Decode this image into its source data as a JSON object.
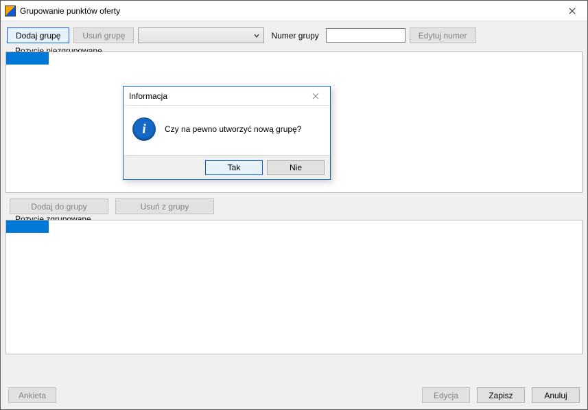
{
  "window": {
    "title": "Grupowanie punktów oferty"
  },
  "toolbar": {
    "add_group": "Dodaj grupę",
    "remove_group": "Usuń grupę",
    "number_label": "Numer grupy",
    "number_value": "",
    "edit_number": "Edytuj numer",
    "combo_selected": ""
  },
  "groups": {
    "ungrouped_label": "Pozycje niezgrupowane",
    "grouped_label": "Pozycje zgrupowane"
  },
  "mid": {
    "add_to_group": "Dodaj do grupy",
    "remove_from_group": "Usuń z grupy"
  },
  "footer": {
    "survey": "Ankieta",
    "edit": "Edycja",
    "save": "Zapisz",
    "cancel": "Anuluj"
  },
  "dialog": {
    "title": "Informacja",
    "message": "Czy na pewno utworzyć nową grupę?",
    "yes": "Tak",
    "no": "Nie"
  }
}
